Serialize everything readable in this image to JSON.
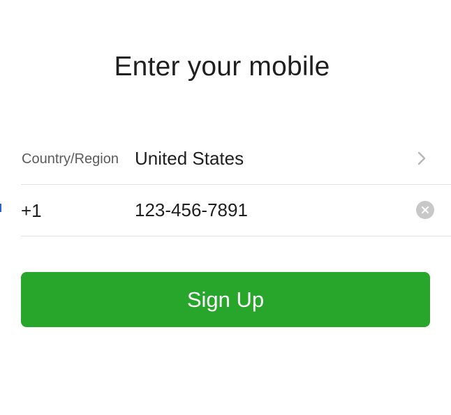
{
  "title": "Enter your mobile",
  "region_row": {
    "label": "Country/Region",
    "value": "United States",
    "chevron_icon": "chevron-right-icon"
  },
  "phone_row": {
    "country_code": "+1",
    "number": "123-456-7891",
    "clear_icon": "clear-circle-icon"
  },
  "signup_button": {
    "label": "Sign Up",
    "color": "#28a62b"
  }
}
